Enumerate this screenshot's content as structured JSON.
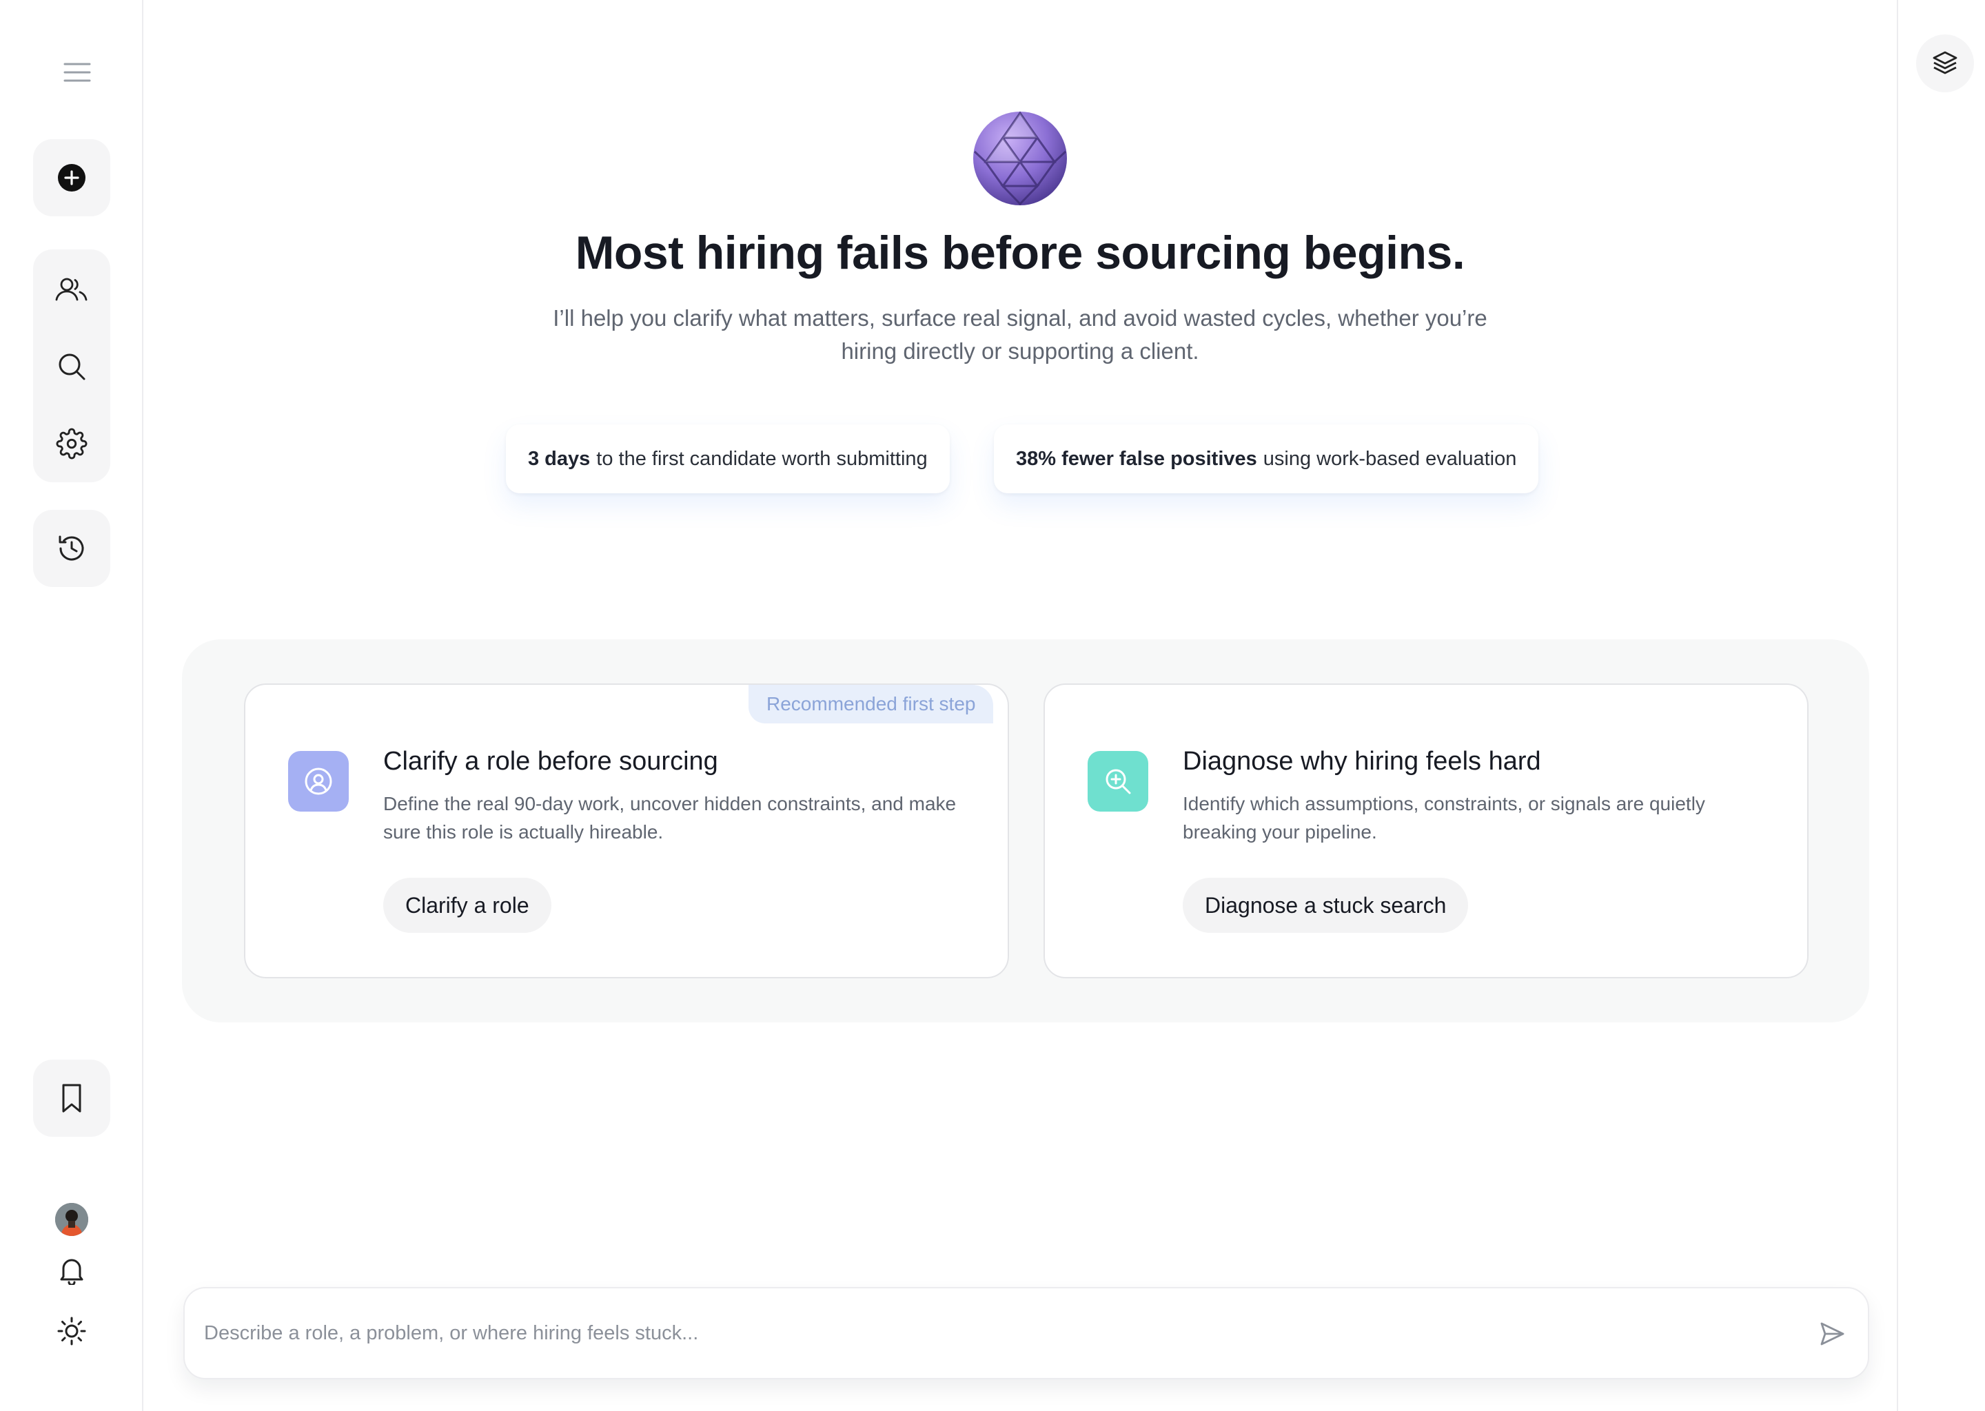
{
  "sidebar": {
    "menu_icon": "hamburger-menu-icon",
    "new_icon": "plus-circle-icon",
    "people_icon": "users-icon",
    "search_icon": "search-icon",
    "settings_icon": "gear-icon",
    "history_icon": "history-icon",
    "bookmark_icon": "bookmark-icon",
    "bell_icon": "bell-icon",
    "theme_icon": "sun-icon"
  },
  "right_rail": {
    "layers_icon": "layers-icon"
  },
  "hero": {
    "title": "Most hiring fails before sourcing begins.",
    "subtitle": "I’ll help you clarify what matters, surface real signal, and avoid wasted cycles, whether you’re hiring directly or supporting a client.",
    "stats": [
      {
        "bold": "3 days",
        "text": "to the first candidate worth submitting"
      },
      {
        "bold": "38% fewer false positives",
        "text": "using work-based evaluation"
      }
    ]
  },
  "cards": [
    {
      "badge": "Recommended first step",
      "icon": "user-circle-icon",
      "icon_color": "#a5b0f3",
      "title": "Clarify a role before sourcing",
      "description": "Define the real 90-day work, uncover hidden constraints, and make sure this role is actually hireable.",
      "button": "Clarify a role"
    },
    {
      "icon": "zoom-in-icon",
      "icon_color": "#6fe0cf",
      "title": "Diagnose why hiring feels hard",
      "description": "Identify which assumptions, constraints, or signals are quietly breaking your pipeline.",
      "button": "Diagnose a stuck search"
    }
  ],
  "composer": {
    "placeholder": "Describe a role, a problem, or where hiring feels stuck...",
    "send_icon": "send-icon"
  },
  "colors": {
    "accent_purple": "#8b6fd4",
    "badge_bg": "#e8effb",
    "badge_text": "#8ba4d8"
  }
}
